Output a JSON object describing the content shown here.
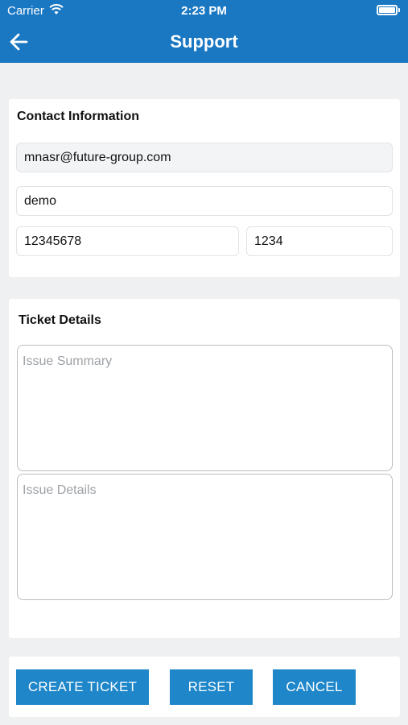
{
  "status_bar": {
    "carrier": "Carrier",
    "time": "2:23 PM"
  },
  "nav": {
    "title": "Support",
    "back_icon": "arrow-left-icon"
  },
  "contact": {
    "title": "Contact Information",
    "email": "mnasr@future-group.com",
    "name": "demo",
    "phone": "12345678",
    "extension": "1234"
  },
  "ticket": {
    "title": "Ticket Details",
    "summary_placeholder": "Issue Summary",
    "details_placeholder": "Issue Details"
  },
  "actions": {
    "create_label": "CREATE TICKET",
    "reset_label": "RESET",
    "cancel_label": "CANCEL"
  },
  "colors": {
    "primary": "#1a77c2",
    "button": "#1e86c9",
    "background": "#eff0f2"
  }
}
